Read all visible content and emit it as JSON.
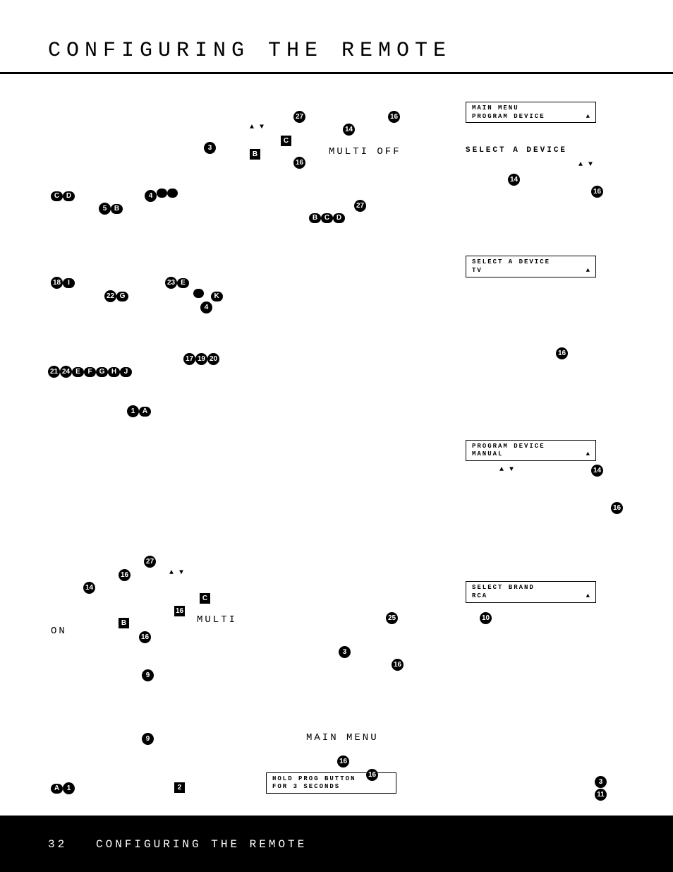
{
  "title": "CONFIGURING THE REMOTE",
  "footer": {
    "page": "32",
    "label": "CONFIGURING THE REMOTE"
  },
  "lcd": {
    "mainMenu": {
      "l1": "MAIN MENU",
      "l2": "PROGRAM DEVICE"
    },
    "selectDeviceHeader": "SELECT A DEVICE",
    "selectDeviceTv": {
      "l1": "SELECT A DEVICE",
      "l2": "TV"
    },
    "programManual": {
      "l1": "PROGRAM DEVICE",
      "l2": "MANUAL"
    },
    "selectBrand": {
      "l1": "SELECT BRAND",
      "l2": "RCA"
    },
    "holdProg": {
      "l1": "HOLD PROG BUTTON",
      "l2": "FOR 3 SECONDS"
    }
  },
  "labels": {
    "multiOff": "MULTI OFF",
    "multi": "MULTI",
    "on": "ON",
    "mainMenu": "MAIN MENU"
  },
  "glyphs": {
    "n1": "1",
    "n2": "2",
    "n3": "3",
    "n4": "4",
    "n5": "5",
    "n9": "9",
    "n10": "10",
    "n11": "11",
    "n14": "14",
    "n16": "16",
    "n17": "17",
    "n18": "18",
    "n19": "19",
    "n20": "20",
    "n21": "21",
    "n22": "22",
    "n23": "23",
    "n24": "24",
    "n25": "25",
    "n27": "27",
    "A": "A",
    "B": "B",
    "C": "C",
    "D": "D",
    "E": "E",
    "F": "F",
    "G": "G",
    "H": "H",
    "I": "I",
    "J": "J",
    "K": "K"
  },
  "arrows": {
    "updown": "▲ ▼",
    "up": "▲"
  }
}
